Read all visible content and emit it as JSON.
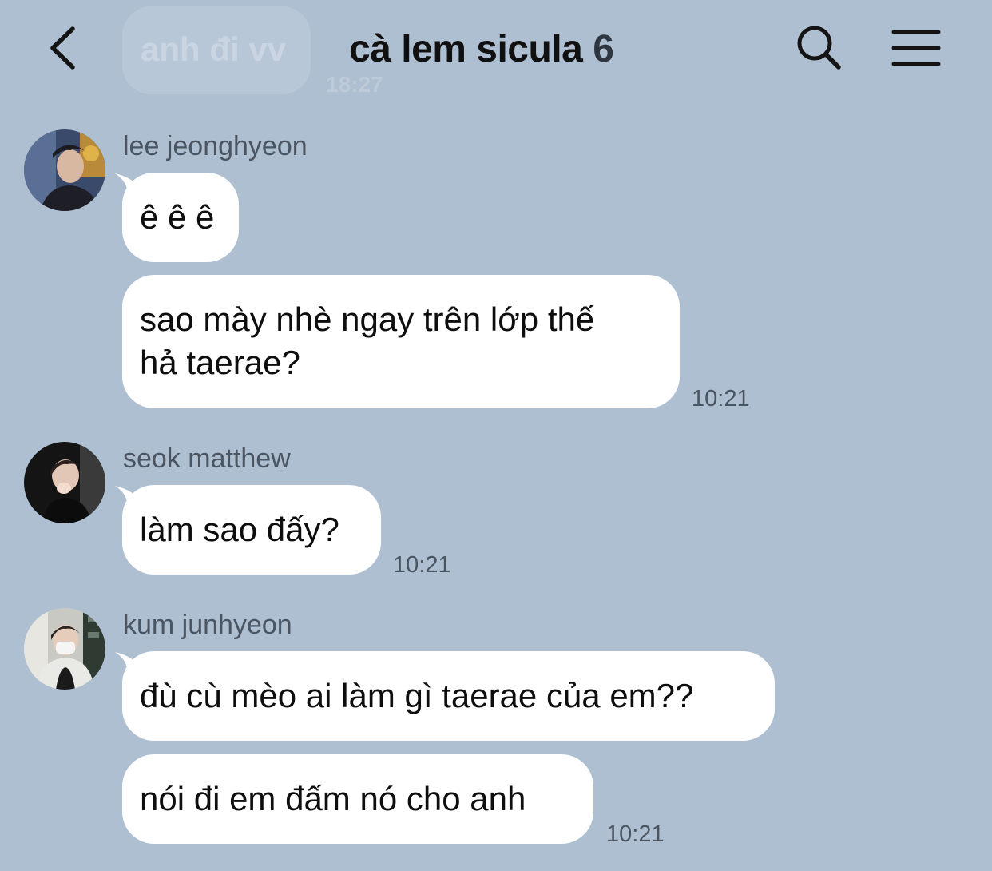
{
  "header": {
    "back_icon": "chevron-left-icon",
    "title": "cà lem sicula",
    "member_count": "6",
    "search_icon": "search-icon",
    "menu_icon": "hamburger-menu-icon",
    "ghost_message": "anh đi vv",
    "ghost_time": "18:27"
  },
  "messages": [
    {
      "sender": "lee jeonghyeon",
      "bubbles": [
        {
          "lines": [
            "ê ê ê"
          ]
        },
        {
          "lines": [
            "sao mày nhè ngay trên lớp thế",
            "hả taerae?"
          ]
        }
      ],
      "time": "10:21"
    },
    {
      "sender": "seok matthew",
      "bubbles": [
        {
          "lines": [
            "làm sao đấy?"
          ]
        }
      ],
      "time": "10:21"
    },
    {
      "sender": "kum junhyeon",
      "bubbles": [
        {
          "lines": [
            "đù cù mèo ai làm gì taerae của em??"
          ]
        },
        {
          "lines": [
            "nói đi em đấm nó cho anh"
          ]
        }
      ],
      "time": "10:21"
    }
  ],
  "colors": {
    "background": "#aebfd1",
    "bubble": "#ffffff",
    "meta_text": "#4b5562"
  }
}
